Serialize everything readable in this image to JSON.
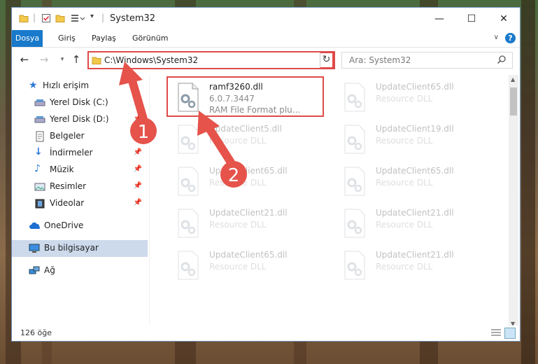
{
  "window": {
    "title": "System32"
  },
  "ribbon": {
    "tabs": [
      "Dosya",
      "Giriş",
      "Paylaş",
      "Görünüm"
    ]
  },
  "address": {
    "path": "C:\\Windows\\System32"
  },
  "search": {
    "placeholder": "Ara: System32"
  },
  "nav": {
    "items": [
      {
        "label": "Hızlı erişim",
        "icon": "star-icon",
        "pinned": false
      },
      {
        "label": "Yerel Disk (C:)",
        "icon": "drive-icon",
        "pinned": true
      },
      {
        "label": "Yerel Disk (D:)",
        "icon": "drive-icon",
        "pinned": true
      },
      {
        "label": "Belgeler",
        "icon": "documents-icon",
        "pinned": true
      },
      {
        "label": "İndirmeler",
        "icon": "download-icon",
        "pinned": true
      },
      {
        "label": "Müzik",
        "icon": "music-icon",
        "pinned": true
      },
      {
        "label": "Resimler",
        "icon": "pictures-icon",
        "pinned": true
      },
      {
        "label": "Videolar",
        "icon": "videos-icon",
        "pinned": true
      },
      {
        "label": "OneDrive",
        "icon": "cloud-icon",
        "pinned": false
      },
      {
        "label": "Bu bilgisayar",
        "icon": "computer-icon",
        "pinned": false
      },
      {
        "label": "Ağ",
        "icon": "network-icon",
        "pinned": false
      }
    ]
  },
  "files": [
    {
      "name": "ramf3260.dll",
      "line2": "6.0.7.3447",
      "line3": "RAM File Format plu..."
    },
    {
      "name": "UpdateClient65.dll",
      "line2": "Resource DLL"
    },
    {
      "name": "UpdateClient5.dll",
      "line2": "Resource DLL"
    },
    {
      "name": "UpdateClient19.dll",
      "line2": "Resource DLL"
    },
    {
      "name": "UpdateClient65.dll",
      "line2": "Resource DLL"
    },
    {
      "name": "UpdateClient65.dll",
      "line2": "Resource DLL"
    },
    {
      "name": "UpdateClient21.dll",
      "line2": "Resource DLL"
    },
    {
      "name": "UpdateClient21.dll",
      "line2": "Resource DLL"
    },
    {
      "name": "UpdateClient65.dll",
      "line2": "Resource DLL"
    },
    {
      "name": "UpdateClient21.dll",
      "line2": "Resource DLL"
    }
  ],
  "status": {
    "count": "126 öğe"
  },
  "annotations": {
    "step1": "1",
    "step2": "2"
  },
  "colors": {
    "accent": "#1979ca",
    "highlight": "#e04a4a",
    "selected": "#ccdaeb"
  }
}
